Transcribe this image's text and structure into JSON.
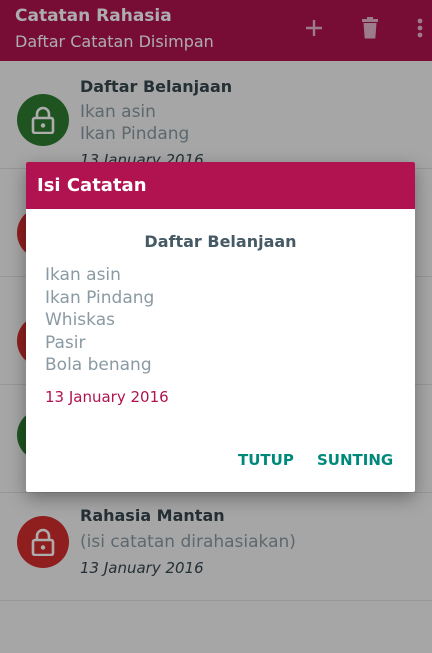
{
  "appbar": {
    "title": "Catatan Rahasia",
    "subtitle": "Daftar Catatan Disimpan",
    "actions": [
      "add-icon",
      "trash-icon",
      "more-vert-icon"
    ]
  },
  "list": [
    {
      "title": "Daftar Belanjaan",
      "lines": [
        "Ikan asin",
        "Ikan Pindang"
      ],
      "date": "13 January 2016",
      "lock_color": "#2e7d32"
    },
    {
      "title": "",
      "lines": [],
      "date": "",
      "lock_color": "#d32f2f"
    },
    {
      "title": "",
      "lines": [],
      "date": "",
      "lock_color": "#d32f2f"
    },
    {
      "title": "",
      "lines": [],
      "date": "",
      "lock_color": "#2e7d32"
    },
    {
      "title": "Rahasia Mantan",
      "lines": [
        "(isi catatan dirahasiakan)"
      ],
      "date": "13 January 2016",
      "lock_color": "#d32f2f"
    }
  ],
  "dialog": {
    "header": "Isi Catatan",
    "title": "Daftar Belanjaan",
    "lines": [
      "Ikan asin",
      "Ikan Pindang",
      "Whiskas",
      "Pasir",
      "Bola benang"
    ],
    "date": "13 January 2016",
    "close_label": "TUTUP",
    "edit_label": "SUNTING"
  },
  "colors": {
    "primary": "#b0134f",
    "accent": "#00897b",
    "lock_open": "#2e7d32",
    "lock_closed": "#d32f2f"
  }
}
